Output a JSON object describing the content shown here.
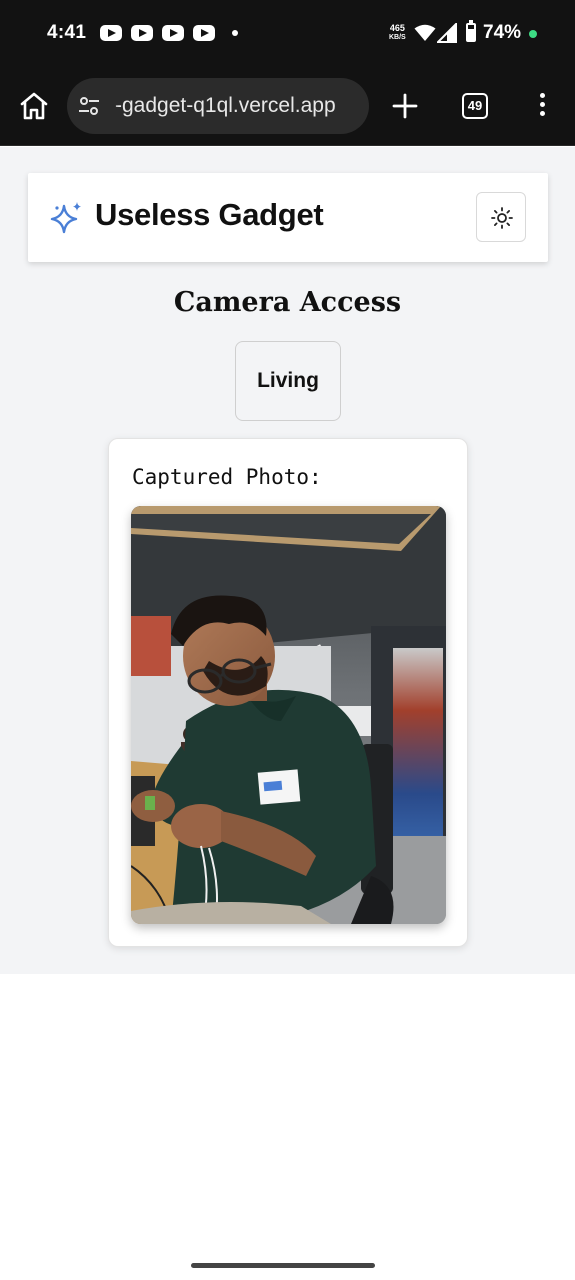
{
  "status_bar": {
    "time": "4:41",
    "net_speed_value": "465",
    "net_speed_unit": "KB/S",
    "battery": "74%",
    "icons": [
      "youtube-icon",
      "youtube-icon",
      "youtube-icon",
      "youtube-icon",
      "wifi-icon",
      "signal-icon",
      "battery-icon"
    ]
  },
  "browser": {
    "url": "-gadget-q1ql.vercel.app",
    "tab_count": "49"
  },
  "app": {
    "title": "Useless Gadget",
    "accent_color": "#4a7fd6"
  },
  "main": {
    "heading": "Camera Access",
    "mode_button": "Living",
    "photo_caption": "Captured Photo:"
  }
}
